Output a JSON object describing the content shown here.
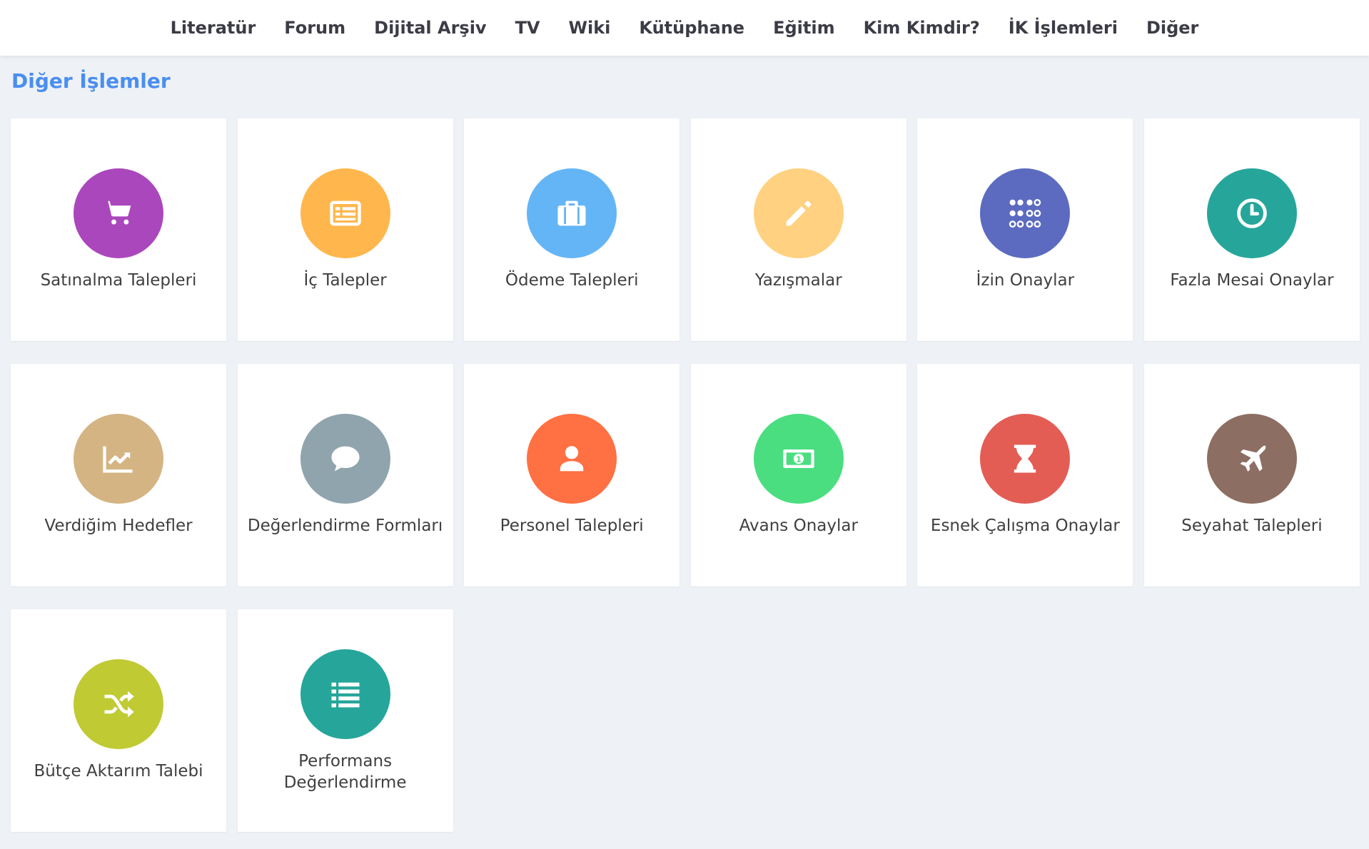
{
  "nav": {
    "items": [
      "Literatür",
      "Forum",
      "Dijital Arşiv",
      "TV",
      "Wiki",
      "Kütüphane",
      "Eğitim",
      "Kim Kimdir?",
      "İK İşlemleri",
      "Diğer"
    ]
  },
  "page": {
    "title": "Diğer İşlemler"
  },
  "cards": [
    {
      "label": "Satınalma Talepleri",
      "icon": "cart-icon",
      "color": "#ab47bc"
    },
    {
      "label": "İç Talepler",
      "icon": "list-card-icon",
      "color": "#ffb74d"
    },
    {
      "label": "Ödeme Talepleri",
      "icon": "briefcase-icon",
      "color": "#64b5f6"
    },
    {
      "label": "Yazışmalar",
      "icon": "pencil-icon",
      "color": "#ffd180"
    },
    {
      "label": "İzin Onaylar",
      "icon": "dots-grid-icon",
      "color": "#5c6bc0"
    },
    {
      "label": "Fazla Mesai Onaylar",
      "icon": "clock-icon",
      "color": "#26a69a"
    },
    {
      "label": "Verdiğim Hedefler",
      "icon": "trend-chart-icon",
      "color": "#d4b483"
    },
    {
      "label": "Değerlendirme Formları",
      "icon": "speech-bubble-icon",
      "color": "#90a4ae"
    },
    {
      "label": "Personel Talepleri",
      "icon": "person-icon",
      "color": "#ff7043"
    },
    {
      "label": "Avans Onaylar",
      "icon": "money-icon",
      "color": "#4ade80"
    },
    {
      "label": "Esnek Çalışma Onaylar",
      "icon": "hourglass-icon",
      "color": "#e35d55"
    },
    {
      "label": "Seyahat Talepleri",
      "icon": "airplane-icon",
      "color": "#8d6e63"
    },
    {
      "label": "Bütçe Aktarım Talebi",
      "icon": "shuffle-icon",
      "color": "#c0ca33"
    },
    {
      "label": "Performans Değerlendirme",
      "icon": "list-icon",
      "color": "#26a69a"
    }
  ]
}
